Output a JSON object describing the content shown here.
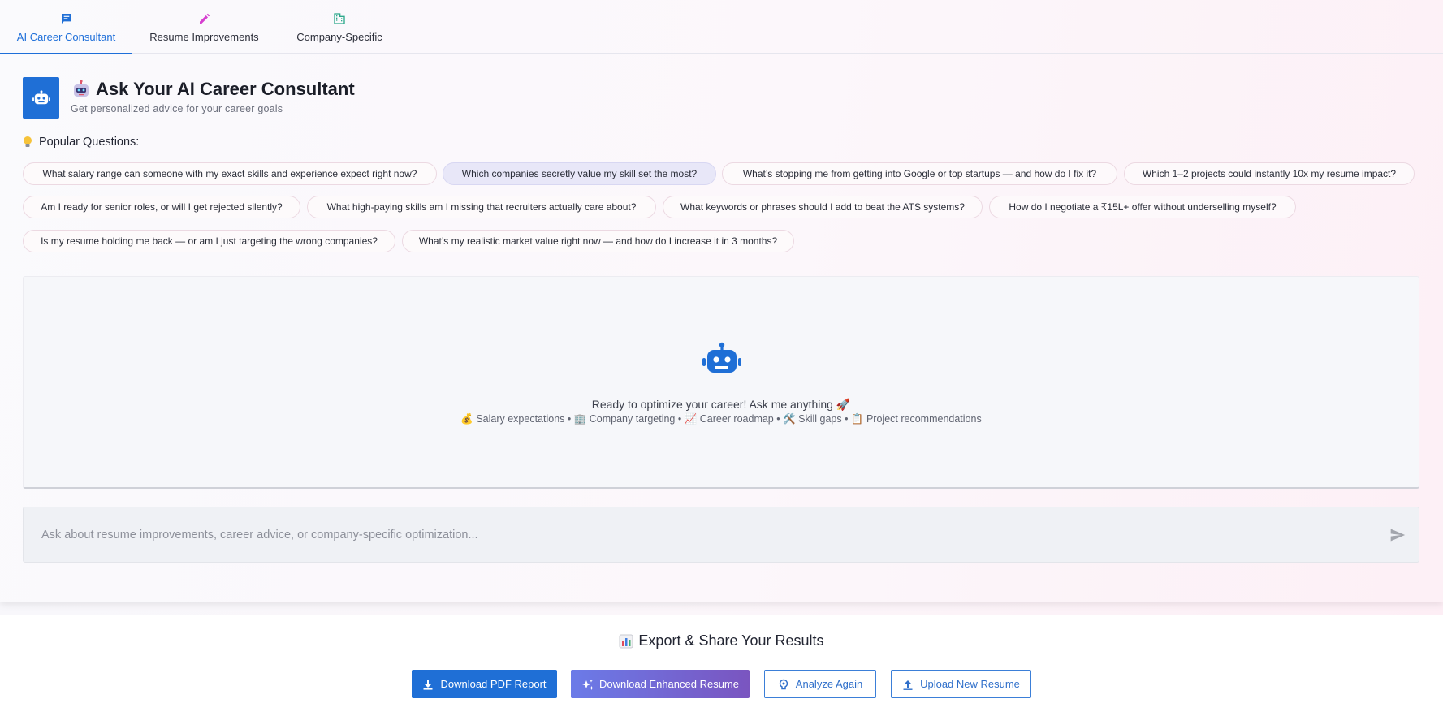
{
  "tabs": [
    {
      "label": "AI Career Consultant",
      "icon": "chat-icon",
      "active": true
    },
    {
      "label": "Resume Improvements",
      "icon": "pencil-icon",
      "active": false
    },
    {
      "label": "Company-Specific",
      "icon": "building-icon",
      "active": false
    }
  ],
  "header": {
    "title": "Ask Your AI Career Consultant",
    "title_emoji": "robot-emoji",
    "subtitle": "Get personalized advice for your career goals"
  },
  "popular": {
    "title": "Popular Questions:",
    "questions": [
      "What salary range can someone with my exact skills and experience expect right now?",
      "Which companies secretly value my skill set the most?",
      "What’s stopping me from getting into Google or top startups — and how do I fix it?",
      "Which 1–2 projects could instantly 10x my resume impact?",
      "Am I ready for senior roles, or will I get rejected silently?",
      "What high-paying skills am I missing that recruiters actually care about?",
      "What keywords or phrases should I add to beat the ATS systems?",
      "How do I negotiate a ₹15L+ offer without underselling myself?",
      "Is my resume holding me back — or am I just targeting the wrong companies?",
      "What’s my realistic market value right now — and how do I increase it in 3 months?"
    ],
    "selected_index": 1
  },
  "chat": {
    "ready_text": "Ready to optimize your career! Ask me anything 🚀",
    "topics": "💰 Salary expectations • 🏢 Company targeting • 📈 Career roadmap • 🛠️ Skill gaps • 📋 Project recommendations"
  },
  "input": {
    "placeholder": "Ask about resume improvements, career advice, or company-specific optimization...",
    "value": ""
  },
  "export": {
    "title": "Export & Share Your Results",
    "buttons": {
      "pdf": "Download PDF Report",
      "enhanced": "Download Enhanced Resume",
      "analyze": "Analyze Again",
      "upload": "Upload New Resume"
    }
  },
  "colors": {
    "accent": "#1f6fd6",
    "gradient_start": "#6b7be8",
    "gradient_end": "#7a55c0",
    "pencil": "#d63fd0",
    "building": "#2ca88a"
  }
}
